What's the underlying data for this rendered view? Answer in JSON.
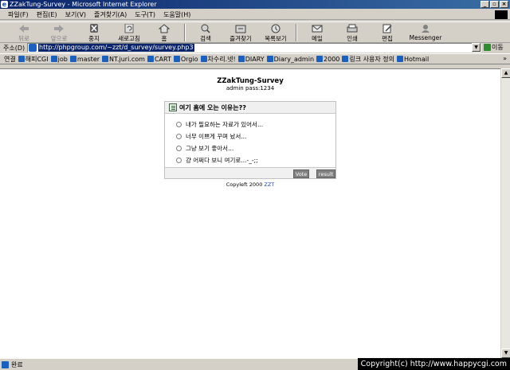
{
  "window": {
    "title": "ZZakTung-Survey - Microsoft Internet Explorer"
  },
  "menu": [
    "파일(F)",
    "편집(E)",
    "보기(V)",
    "즐겨찾기(A)",
    "도구(T)",
    "도움말(H)"
  ],
  "toolbar": [
    {
      "name": "back-button",
      "label": "뒤로",
      "icon": "back-arrow-icon",
      "disabled": true
    },
    {
      "name": "forward-button",
      "label": "앞으로",
      "icon": "forward-arrow-icon",
      "disabled": true
    },
    {
      "name": "stop-button",
      "label": "중지",
      "icon": "stop-icon"
    },
    {
      "name": "refresh-button",
      "label": "새로고침",
      "icon": "refresh-icon"
    },
    {
      "name": "home-button",
      "label": "홈",
      "icon": "home-icon"
    },
    {
      "name": "search-button",
      "label": "검색",
      "icon": "search-icon"
    },
    {
      "name": "favorites-button",
      "label": "즐겨찾기",
      "icon": "favorites-icon"
    },
    {
      "name": "history-button",
      "label": "목록보기",
      "icon": "history-icon"
    },
    {
      "name": "mail-button",
      "label": "메일",
      "icon": "mail-icon"
    },
    {
      "name": "print-button",
      "label": "인쇄",
      "icon": "print-icon"
    },
    {
      "name": "edit-button",
      "label": "편집",
      "icon": "edit-icon"
    },
    {
      "name": "messenger-button",
      "label": "Messenger",
      "icon": "messenger-icon"
    }
  ],
  "address": {
    "label": "주소(D)",
    "url": "http://phpgroup.com/~zzt/d_survey/survey.php3",
    "go": "이동"
  },
  "links": {
    "label": "연결",
    "items": [
      "해피CGI",
      "job",
      "master",
      "NT.juri.com",
      "CART",
      "Orgio",
      "차수리.넷!",
      "DIARY",
      "Diary_admin",
      "2000",
      "링크 사용자 정의",
      "Hotmail"
    ],
    "more": "»"
  },
  "page": {
    "title": "ZZakTung-Survey",
    "subtitle": "admin pass:1234",
    "question": "여기 홈에 오는 이유는??",
    "options": [
      "내가 필요하는 자료가 있어서...",
      "너무 이쁘게 꾸며 놨서...",
      "그냥 보기 좋아서...",
      "걍 어쩌다 보니 여기로...-_-;;"
    ],
    "vote_label": "Vote",
    "result_label": "result",
    "copyleft": "Copyleft 2000 ",
    "copyleft_link": "ZZT"
  },
  "status": {
    "text": "완료"
  },
  "watermark": "Copyright(c) http://www.happycgi.com"
}
